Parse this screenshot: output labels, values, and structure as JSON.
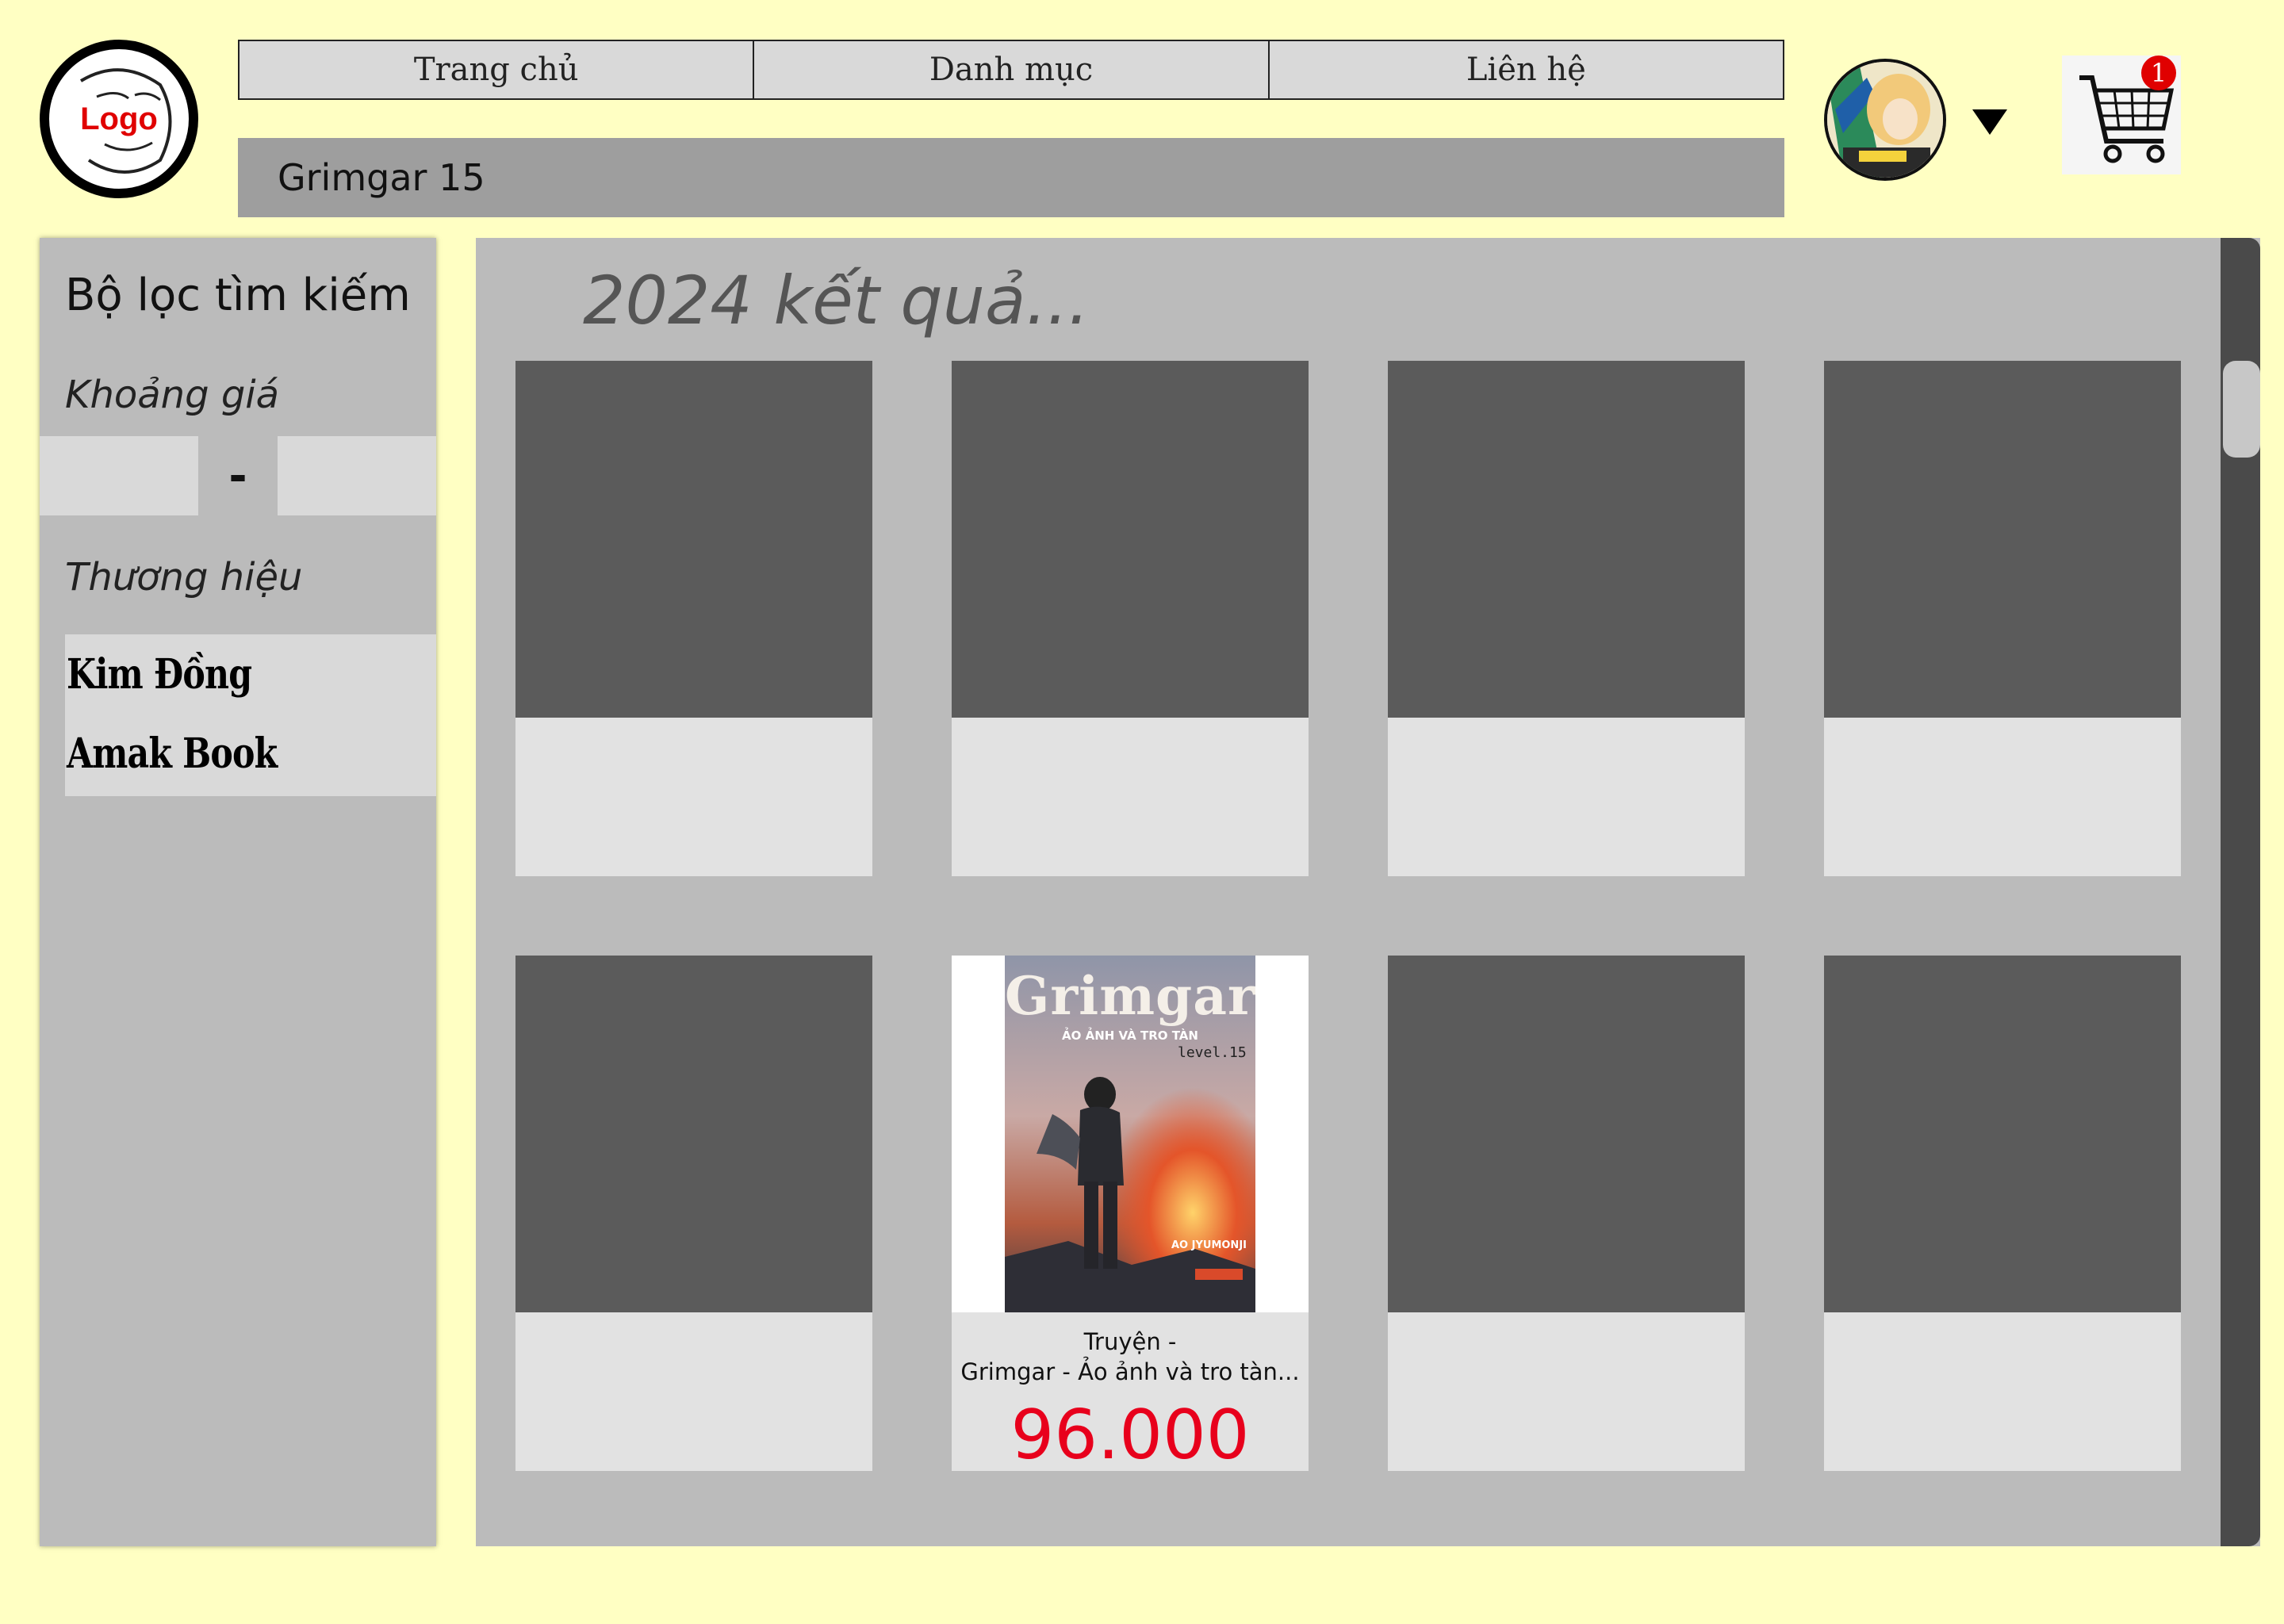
{
  "logo": {
    "text": "Logo"
  },
  "nav": {
    "items": [
      "Trang chủ",
      "Danh mục",
      "Liên hệ"
    ]
  },
  "search": {
    "value": "Grimgar 15"
  },
  "cart": {
    "badge": "1"
  },
  "sidebar": {
    "title": "Bộ lọc tìm kiếm",
    "price_label": "Khoảng giá",
    "price_separator": "-",
    "brand_label": "Thương hiệu",
    "brands": [
      "Kim Đồng",
      "Amak Book"
    ]
  },
  "results": {
    "count_text": "2024 kết quả...",
    "featured": {
      "cover_title": "Grimgar",
      "cover_subtitle": "ẢO ẢNH VÀ TRO TÀN",
      "cover_level": "level.15",
      "cover_author": "AO JYUMONJI",
      "title_line1": "Truyện -",
      "title_line2": "Grimgar - Ảo ảnh và tro tàn...",
      "price": "96.000"
    }
  },
  "colors": {
    "background": "#ffffc3",
    "panel": "#bbbbbb",
    "placeholder": "#5b5b5b",
    "price": "#e8001c",
    "badge": "#e00000"
  }
}
